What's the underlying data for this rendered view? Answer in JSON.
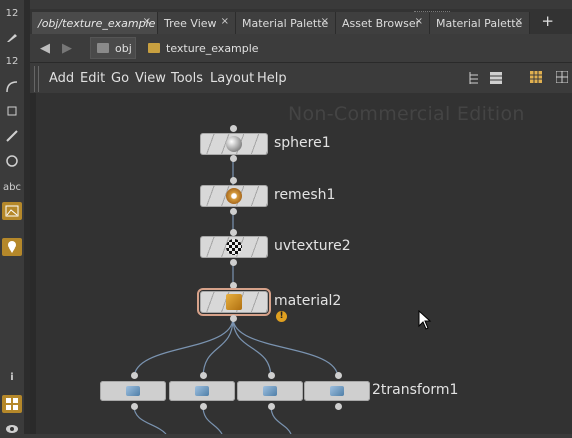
{
  "left_toolbar": {
    "tools": [
      {
        "icon": "tool-12-icon",
        "label": "12"
      },
      {
        "icon": "brush-icon",
        "label": ""
      },
      {
        "icon": "paint-icon",
        "label": ""
      },
      {
        "icon": "tool-12b-icon",
        "label": "12"
      },
      {
        "icon": "curve-icon",
        "label": ""
      },
      {
        "icon": "transform-icon",
        "label": ""
      },
      {
        "icon": "edge-icon",
        "label": ""
      },
      {
        "icon": "node-icon",
        "label": ""
      },
      {
        "icon": "text-icon",
        "label": "abc"
      },
      {
        "icon": "image-icon",
        "label": ""
      },
      {
        "icon": "pin-icon",
        "label": ""
      },
      {
        "icon": "info-icon",
        "label": "i"
      },
      {
        "icon": "grid-icon",
        "label": ""
      },
      {
        "icon": "eye-icon",
        "label": ""
      }
    ]
  },
  "tabs": [
    {
      "label": "/obj/texture_example",
      "active": true
    },
    {
      "label": "Tree View",
      "active": false
    },
    {
      "label": "Material Palette",
      "active": false
    },
    {
      "label": "Asset Browser",
      "active": false
    },
    {
      "label": "Material Palette",
      "active": false
    }
  ],
  "tab_close": "×",
  "tab_add": "+",
  "path": {
    "back": "◀",
    "forward": "▶",
    "crumb1": "obj",
    "crumb2": "texture_example"
  },
  "menu": [
    "Add",
    "Edit",
    "Go",
    "View",
    "Tools",
    "Layout",
    "Help"
  ],
  "watermark": "Non-Commercial Edition",
  "nodes": {
    "sphere1": "sphere1",
    "remesh1": "remesh1",
    "uvtexture2": "uvtexture2",
    "material2": "material2",
    "transform": "2transform1"
  },
  "warning_glyph": "!",
  "colors": {
    "accent": "#b5882a",
    "node_body": "#d8d8d8",
    "wire": "#7a93b0",
    "selection": "#d7a28a"
  }
}
